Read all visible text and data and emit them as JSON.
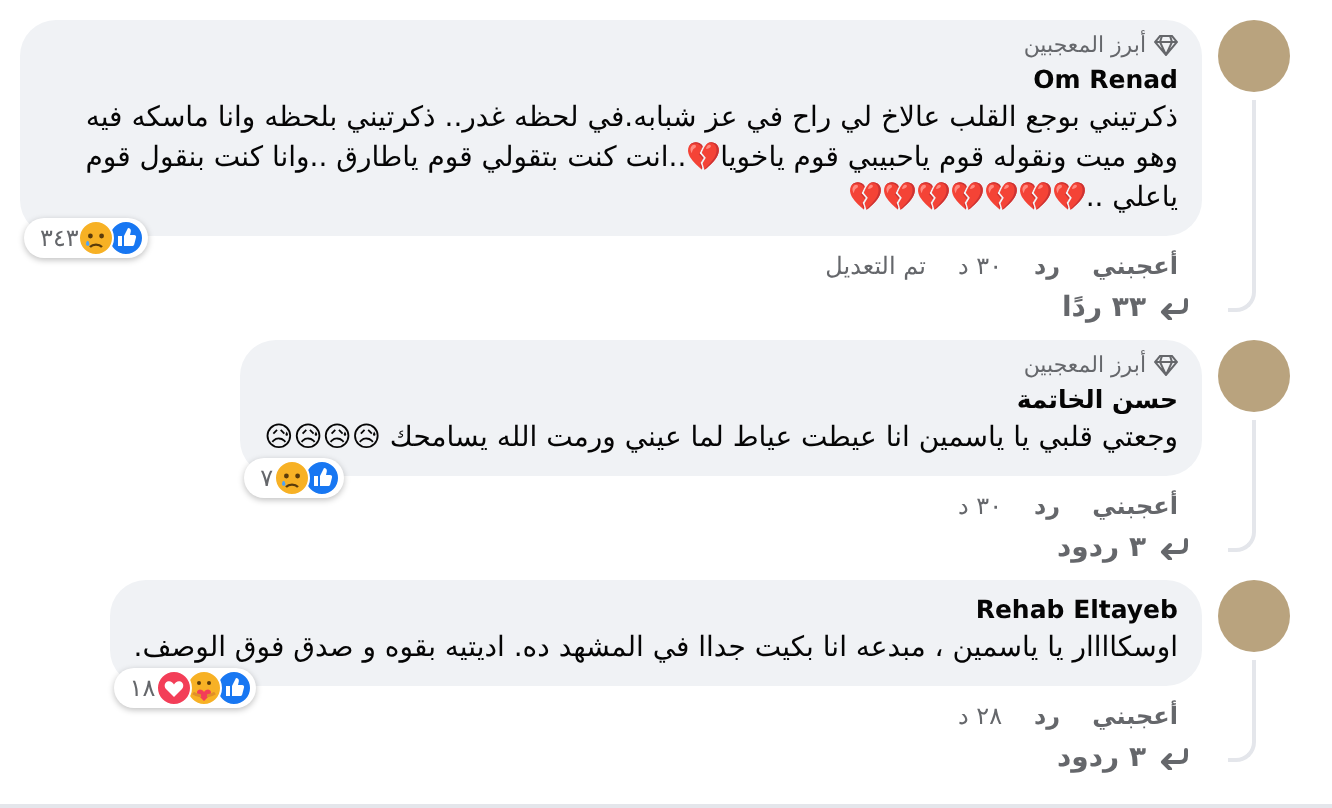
{
  "comments": [
    {
      "badge": "أبرز المعجبين",
      "author": "Om Renad",
      "text": "ذكرتيني بوجع القلب عالاخ لي راح في عز شبابه.في لحظه غدر.. ذكرتيني بلحظه وانا ماسكه فيه وهو ميت ونقوله قوم ياحبيبي قوم ياخويا💔..انت كنت بتقولي قوم ياطارق ..وانا كنت بنقول قوم ياعلي ..💔💔💔💔💔💔💔",
      "reactions": [
        {
          "kind": "like"
        },
        {
          "kind": "sad"
        }
      ],
      "reaction_count": "٣٤٣",
      "like": "أعجبني",
      "reply": "رد",
      "time": "٣٠ د",
      "edited": "تم التعديل",
      "replies": "٣٣ ردًا"
    },
    {
      "badge": "أبرز المعجبين",
      "author": "حسن الخاتمة",
      "text": "وجعتي قلبي يا ياسمين انا عيطت عياط لما عيني ورمت الله يسامحك 😥😥😥😥",
      "reactions": [
        {
          "kind": "like"
        },
        {
          "kind": "sad"
        }
      ],
      "reaction_count": "٧",
      "like": "أعجبني",
      "reply": "رد",
      "time": "٣٠ د",
      "replies": "٣ ردود"
    },
    {
      "author": "Rehab Eltayeb",
      "text": "اوسكاااار يا ياسمين ، مبدعه انا بكيت جداا في المشهد ده. اديتيه بقوه و صدق فوق الوصف.",
      "reactions": [
        {
          "kind": "like"
        },
        {
          "kind": "care"
        },
        {
          "kind": "love"
        }
      ],
      "reaction_count": "١٨",
      "like": "أعجبني",
      "reply": "رد",
      "time": "٢٨ د",
      "replies": "٣ ردود"
    }
  ]
}
